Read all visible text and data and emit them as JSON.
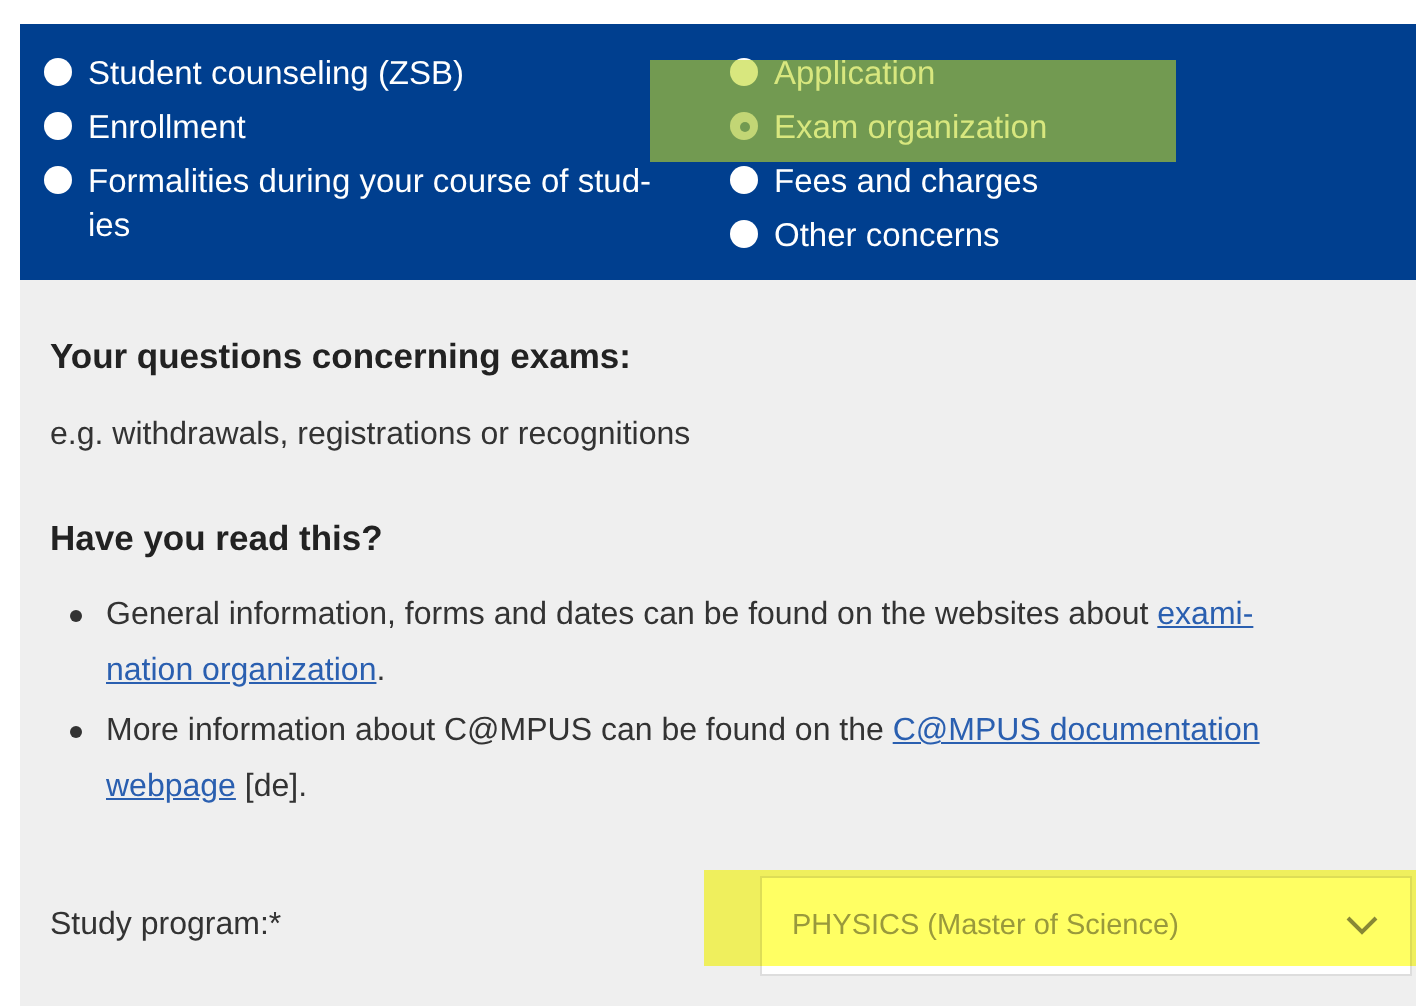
{
  "concerns": [
    {
      "label": "Student counseling (ZSB)",
      "selected": false
    },
    {
      "label": "Enrollment",
      "selected": false
    },
    {
      "label": "Formalities during your course of stud-\nies",
      "selected": false
    },
    {
      "label": "Application",
      "selected": false
    },
    {
      "label": "Exam organization",
      "selected": true
    },
    {
      "label": "Fees and charges",
      "selected": false
    },
    {
      "label": "Other concerns",
      "selected": false
    }
  ],
  "section_title": "Your questions concerning exams:",
  "section_text": "e.g. withdrawals, registrations or recognitions",
  "read_title": "Have you read this?",
  "bullets": [
    {
      "lines": [
        [
          {
            "kind": "text",
            "text": "General information, forms and dates can be found on the websites about "
          },
          {
            "kind": "link",
            "text": "exami-"
          }
        ],
        [
          {
            "kind": "link",
            "text": "nation organization"
          },
          {
            "kind": "text",
            "text": "."
          }
        ]
      ]
    },
    {
      "lines": [
        [
          {
            "kind": "text",
            "text": "More information about C@MPUS can be found on the "
          },
          {
            "kind": "link",
            "text": "C@MPUS documentation"
          }
        ],
        [
          {
            "kind": "link",
            "text": "webpage"
          },
          {
            "kind": "text",
            "text": " [de]."
          }
        ]
      ]
    }
  ],
  "study_program": {
    "label": "Study program:*",
    "value": "PHYSICS (Master of Science)"
  }
}
